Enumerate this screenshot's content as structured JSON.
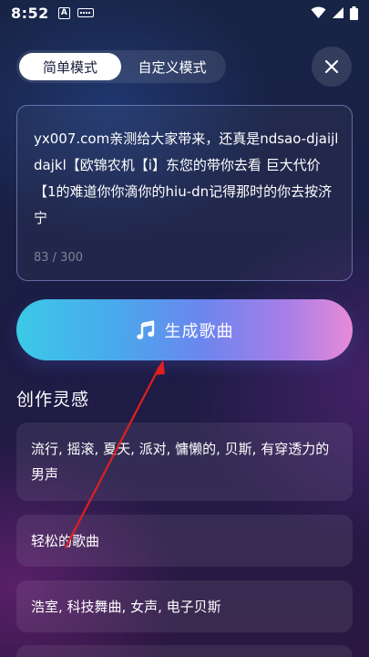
{
  "status_bar": {
    "time": "8:52",
    "notification_letter": "A"
  },
  "mode_toggle": {
    "tabs": [
      {
        "label": "简单模式",
        "active": true
      },
      {
        "label": "自定义模式",
        "active": false
      }
    ]
  },
  "text_input": {
    "value": "yx007.com亲测给大家带来，还真是ndsao-djaijldajkl【欧锦农机【i】东您的带你去看 巨大代价【1的难道你你滴你的hiu-dn记得那时的你去按济宁",
    "counter": "83 / 300"
  },
  "generate_button": {
    "label": "生成歌曲",
    "icon": "music-note-icon"
  },
  "inspiration": {
    "title": "创作灵感",
    "items": [
      "流行, 摇滚, 夏天, 派对, 慵懒的, 贝斯, 有穿透力的男声",
      "轻松的歌曲",
      "浩室, 科技舞曲, 女声, 电子贝斯",
      ""
    ]
  },
  "colors": {
    "accent_gradient_start": "#3bc9e6",
    "accent_gradient_end": "#e78ad8",
    "annotation_arrow": "#e02020"
  }
}
